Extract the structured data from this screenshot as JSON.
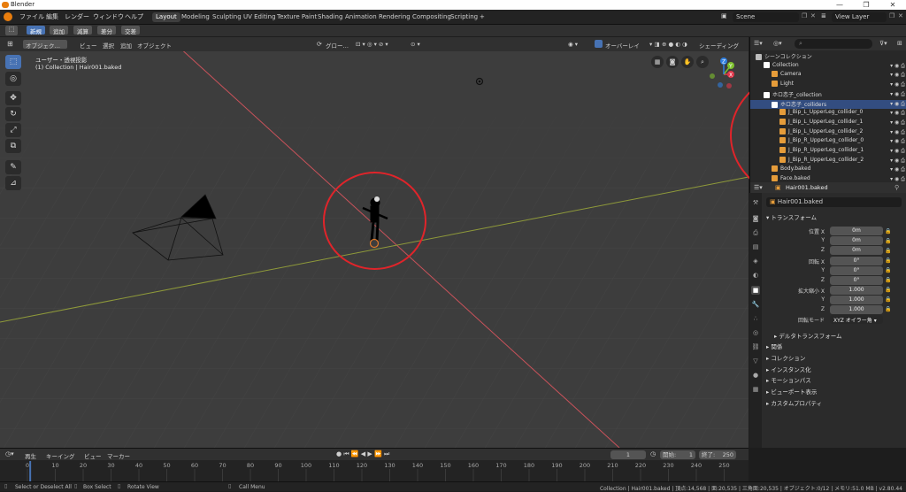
{
  "window": {
    "title": "Blender",
    "controls": [
      "—",
      "❐",
      "✕"
    ]
  },
  "menu": [
    "ファイル",
    "編集",
    "レンダー",
    "ウィンドウ",
    "ヘルプ"
  ],
  "workspaces": [
    "Layout",
    "Modeling",
    "Sculpting",
    "UV Editing",
    "Texture Paint",
    "Shading",
    "Animation",
    "Rendering",
    "Compositing",
    "Scripting",
    "+"
  ],
  "active_workspace": "Layout",
  "scene": {
    "name": "Scene",
    "view_layer": "View Layer"
  },
  "modes": [
    "新規",
    "追加",
    "減算",
    "差分",
    "交差"
  ],
  "viewport_header": {
    "mode": "オブジェク…",
    "menus": [
      "ビュー",
      "選択",
      "追加",
      "オブジェクト"
    ],
    "transform": "グロー…",
    "overlay": "オーバーレイ",
    "shading": "シェーディング"
  },
  "viewport_overlay": {
    "line1": "ユーザー・透視投影",
    "line2": "(1) Collection | Hair001.baked"
  },
  "gizmo": {
    "x": "X",
    "y": "Y",
    "z": "Z",
    "x_color": "#e0364a",
    "y_color": "#7ec22d",
    "z_color": "#2f7fe0"
  },
  "outliner": {
    "search_placeholder": "",
    "items": [
      {
        "label": "シーンコレクション",
        "depth": 0,
        "color": "#bbbbbb"
      },
      {
        "label": "Collection",
        "depth": 1,
        "color": "#ffffff"
      },
      {
        "label": "Camera",
        "depth": 2,
        "color": "#e59c3a"
      },
      {
        "label": "Light",
        "depth": 2,
        "color": "#e59c3a"
      },
      {
        "label": "ホロ恋子_collection",
        "depth": 1,
        "color": "#ffffff"
      },
      {
        "label": "ホロ恋子_colliders",
        "depth": 2,
        "color": "#ffffff",
        "selected": true
      },
      {
        "label": "J_Bip_L_UpperLeg_collider_0",
        "depth": 3,
        "color": "#e59c3a"
      },
      {
        "label": "J_Bip_L_UpperLeg_collider_1",
        "depth": 3,
        "color": "#e59c3a"
      },
      {
        "label": "J_Bip_L_UpperLeg_collider_2",
        "depth": 3,
        "color": "#e59c3a"
      },
      {
        "label": "J_Bip_R_UpperLeg_collider_0",
        "depth": 3,
        "color": "#e59c3a"
      },
      {
        "label": "J_Bip_R_UpperLeg_collider_1",
        "depth": 3,
        "color": "#e59c3a"
      },
      {
        "label": "J_Bip_R_UpperLeg_collider_2",
        "depth": 3,
        "color": "#e59c3a"
      },
      {
        "label": "Body.baked",
        "depth": 2,
        "color": "#e59c3a"
      },
      {
        "label": "Face.baked",
        "depth": 2,
        "color": "#e59c3a"
      }
    ]
  },
  "properties": {
    "object_name": "Hair001.baked",
    "field_name": "Hair001.baked",
    "transform_title": "トランスフォーム",
    "location": {
      "label": "位置 X",
      "x": "0m",
      "y": "0m",
      "z": "0m"
    },
    "rotation": {
      "label": "回転 X",
      "x": "0°",
      "y": "0°",
      "z": "0°"
    },
    "scale": {
      "label": "拡大縮小 X",
      "x": "1.000",
      "y": "1.000",
      "z": "1.000"
    },
    "axis_y": "Y",
    "axis_z": "Z",
    "rotation_mode_label": "回転モード",
    "rotation_mode": "XYZ オイラー角",
    "sections": [
      "デルタトランスフォーム",
      "関係",
      "コレクション",
      "インスタンス化",
      "モーションパス",
      "ビューポート表示",
      "カスタムプロパティ"
    ]
  },
  "timeline": {
    "menus": [
      "再生",
      "キーイング",
      "ビュー",
      "マーカー"
    ],
    "current_frame": "1",
    "start_label": "開始:",
    "start": "1",
    "end_label": "終了:",
    "end": "250",
    "ticks": [
      "0",
      "10",
      "20",
      "30",
      "40",
      "50",
      "60",
      "70",
      "80",
      "90",
      "100",
      "110",
      "120",
      "130",
      "140",
      "150",
      "160",
      "170",
      "180",
      "190",
      "200",
      "210",
      "220",
      "230",
      "240",
      "250"
    ]
  },
  "status": {
    "select": "Select or Deselect All",
    "box": "Box Select",
    "rotate": "Rotate View",
    "menu": "Call Menu",
    "info": "Collection | Hair001.baked | 頂点:14,568 | 面:20,535 | 三角面:20,535 | オブジェクト:0/12 | メモリ:51.0 MB | v2.80.44"
  },
  "annotation_color": "#e0242a"
}
